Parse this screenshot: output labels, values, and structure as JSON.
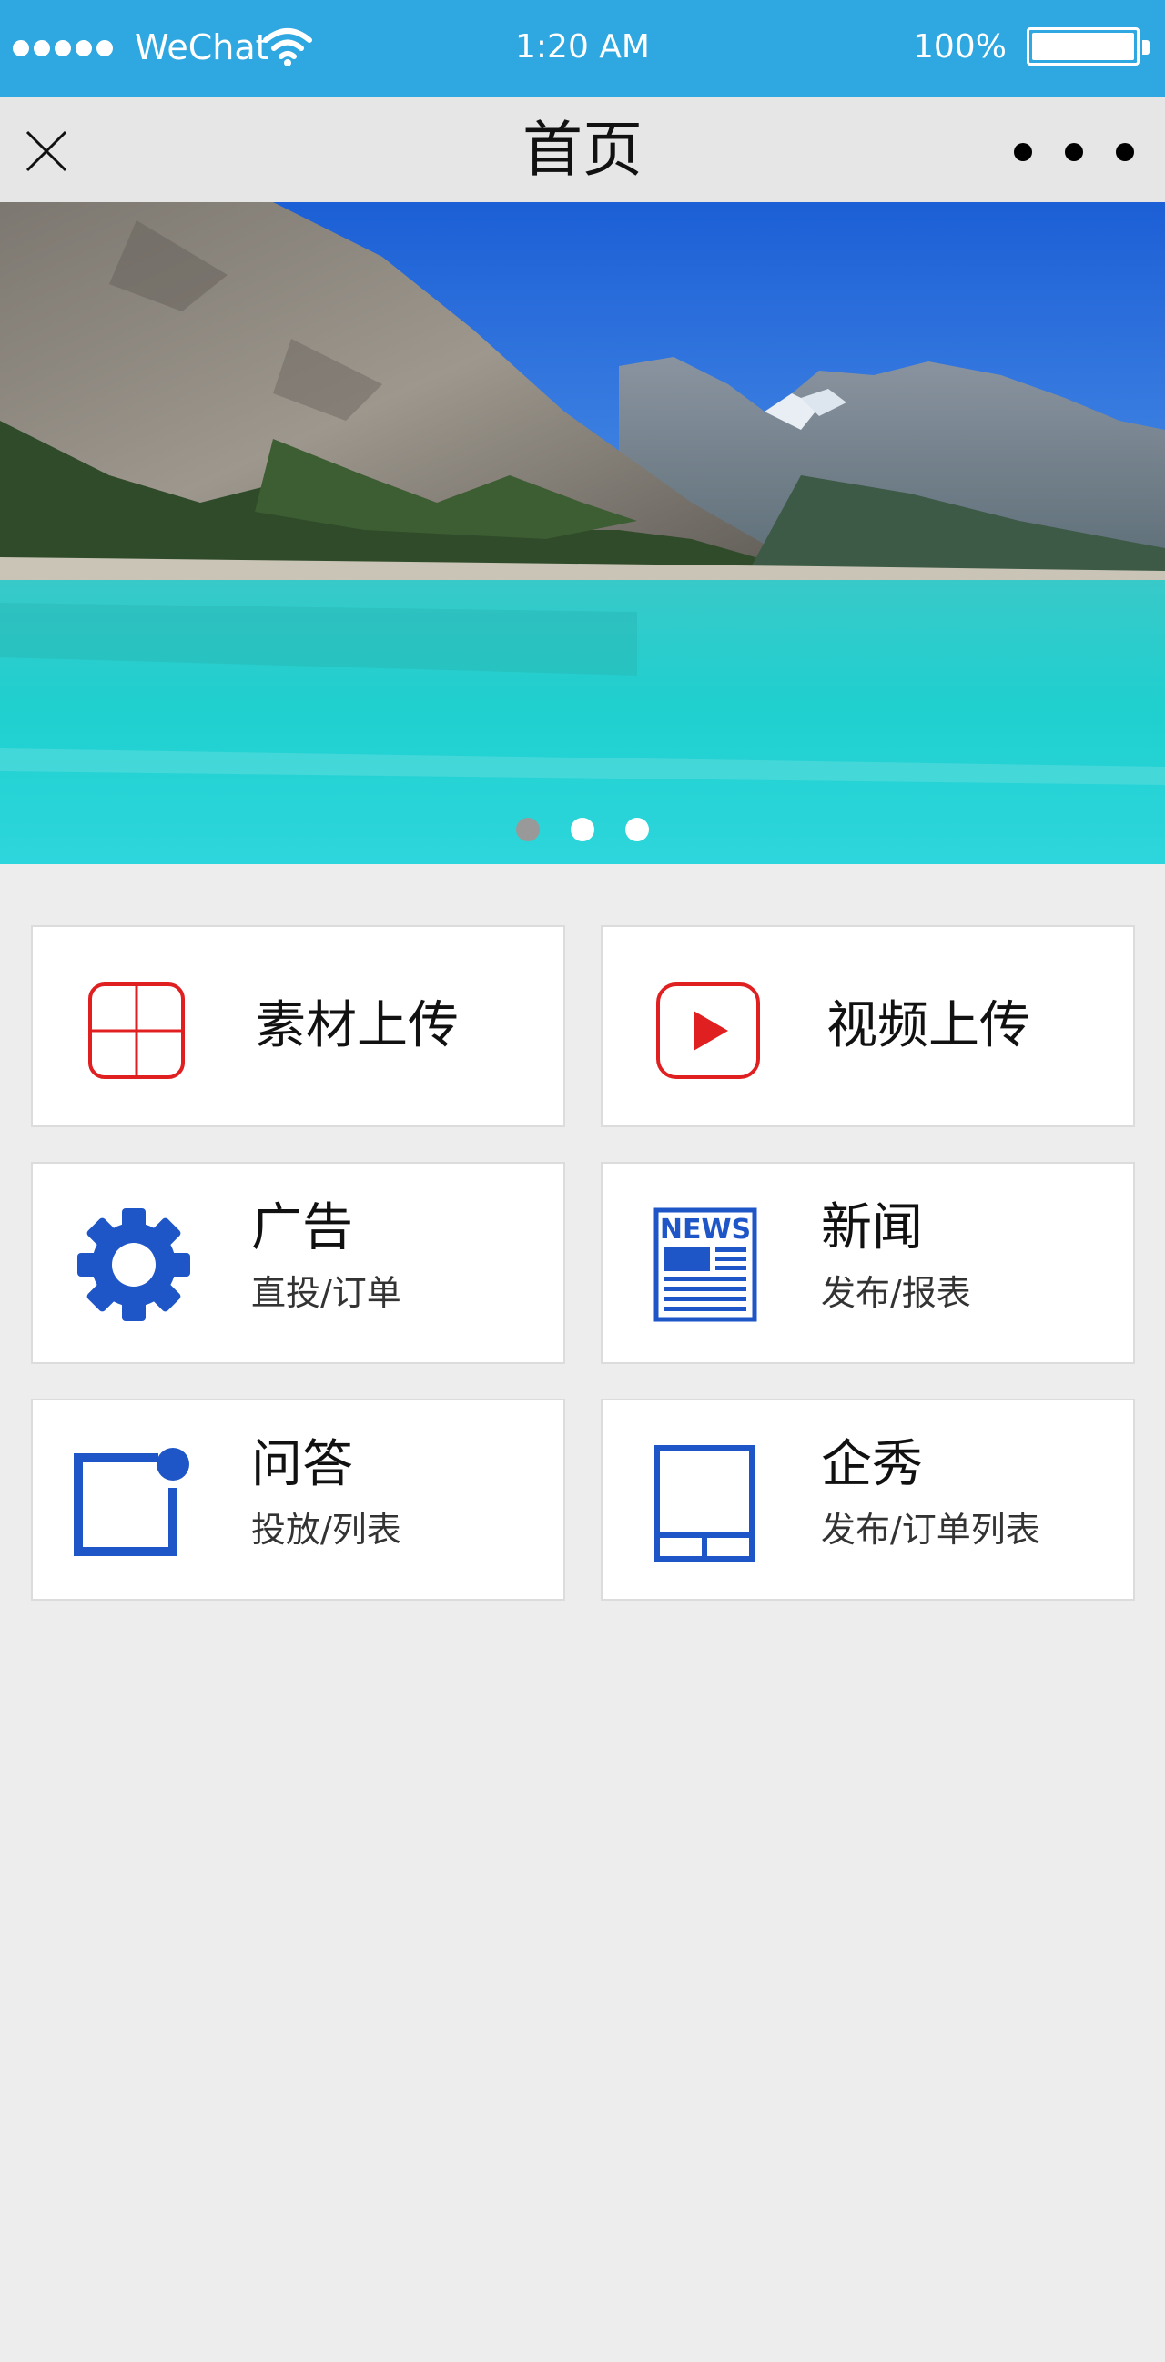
{
  "status_bar": {
    "carrier": "WeChat",
    "time": "1:20 AM",
    "battery": "100%",
    "battery_level": 1.0
  },
  "nav": {
    "title": "首页",
    "close_icon": "close-icon",
    "more_icon": "more-dots-icon"
  },
  "banner": {
    "image": "mountain-lake-landscape",
    "page_count": 3,
    "active_page": 1
  },
  "menu": [
    {
      "title": "素材上传",
      "subtitle": "",
      "icon": "plus-square-icon",
      "color": "#e02020"
    },
    {
      "title": "视频上传",
      "subtitle": "",
      "icon": "play-square-icon",
      "color": "#e02020"
    },
    {
      "title": "广告",
      "subtitle": "直投/订单",
      "icon": "gear-icon",
      "color": "#1e56c8"
    },
    {
      "title": "新闻",
      "subtitle": "发布/报表",
      "icon": "newspaper-icon",
      "color": "#1e56c8"
    },
    {
      "title": "问答",
      "subtitle": "投放/列表",
      "icon": "notification-square-icon",
      "color": "#1e56c8"
    },
    {
      "title": "企秀",
      "subtitle": "发布/订单列表",
      "icon": "tablet-layout-icon",
      "color": "#1e56c8"
    }
  ],
  "colors": {
    "status_bar": "#2fa7e0",
    "nav_bar": "#e6e6e6",
    "page_bg": "#ededed",
    "accent_red": "#e02020",
    "accent_blue": "#1e56c8"
  }
}
